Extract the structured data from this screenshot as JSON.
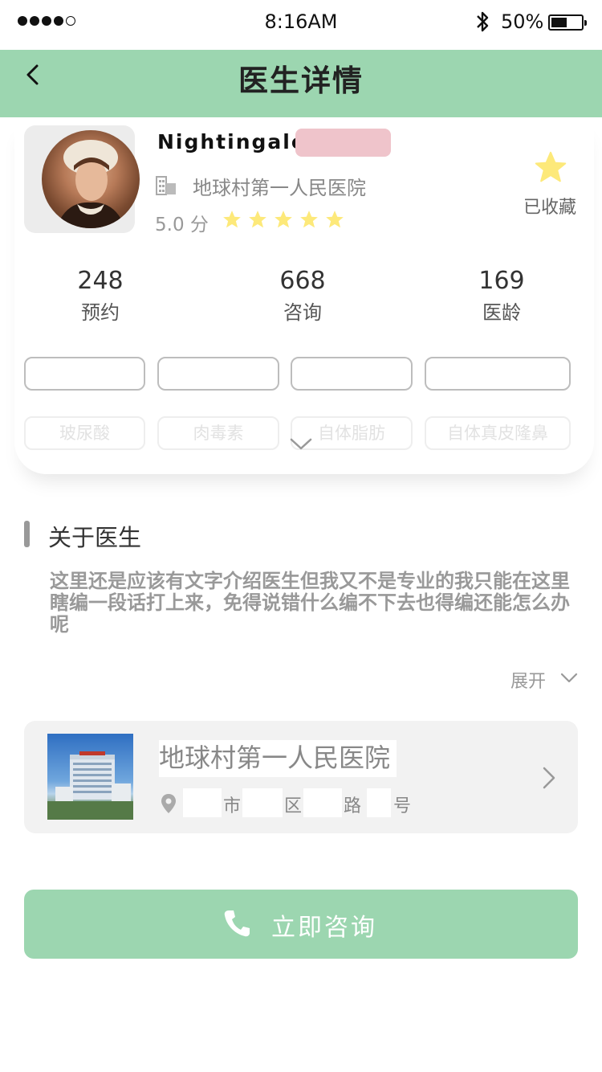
{
  "status_bar": {
    "time": "8:16AM",
    "battery": "50%",
    "battery_fraction": 0.5,
    "signal_bars": 4,
    "icons": [
      "signal-dots-icon",
      "bluetooth-icon",
      "battery-icon"
    ]
  },
  "nav": {
    "title": "医生详情",
    "back_icon": "chevron-left-icon"
  },
  "doctor": {
    "name": "Nightingale",
    "hospital": "地球村第一人民医院",
    "rating_text": "5.0 分",
    "rating_stars": 5,
    "favorite_label": "已收藏",
    "star_color": "#fde97a",
    "stats": [
      {
        "value": "248",
        "label": "预约"
      },
      {
        "value": "668",
        "label": "咨询"
      },
      {
        "value": "169",
        "label": "医龄"
      }
    ],
    "tags_row1": [
      "",
      "",
      "",
      ""
    ],
    "tags_row2": [
      "玻尿酸",
      "肉毒素",
      "自体脂肪",
      "自体真皮隆鼻"
    ]
  },
  "about": {
    "title": "关于医生",
    "text": "这里还是应该有文字介绍医生但我又不是专业的我只能在这里瞎编一段话打上来，免得说错什么编不下去也得编还能怎么办呢",
    "more_label": "展开"
  },
  "hospital_card": {
    "name": "地球村第一人民医院",
    "address_parts": [
      "市",
      "区",
      "路",
      "号"
    ]
  },
  "consult": {
    "label": "立即咨询"
  },
  "colors": {
    "brand": "#9cd6b0",
    "star": "#fde97a"
  }
}
